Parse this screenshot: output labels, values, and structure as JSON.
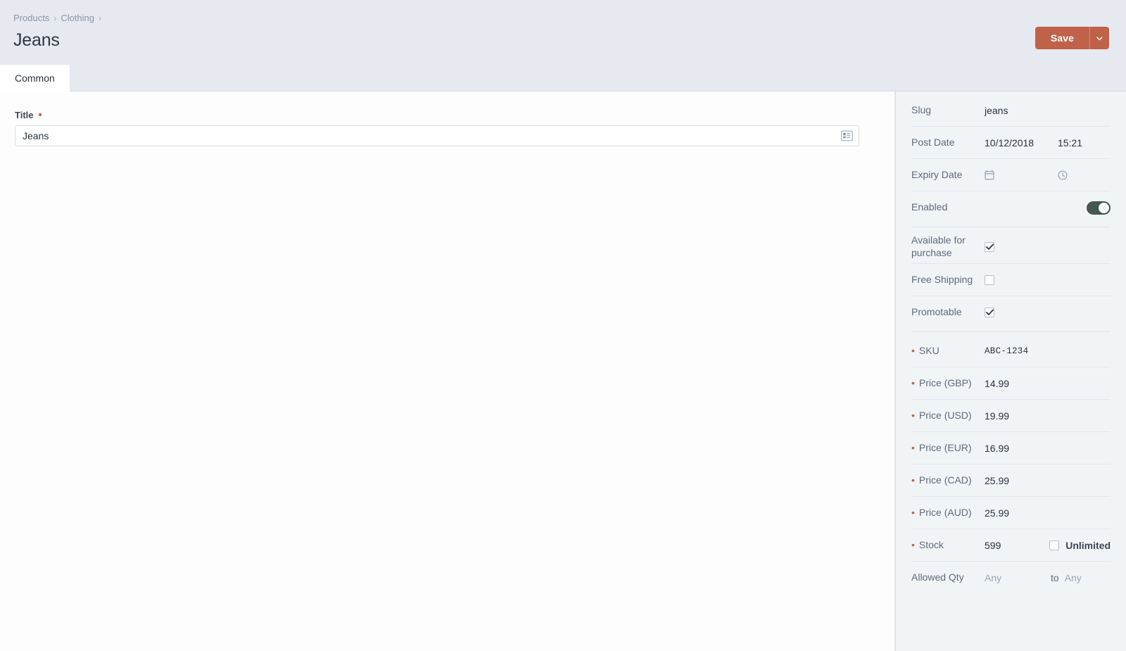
{
  "header": {
    "breadcrumb": [
      {
        "label": "Products"
      },
      {
        "label": "Clothing"
      }
    ],
    "breadcrumb_separator": "›",
    "title": "Jeans",
    "save_label": "Save",
    "save_menu_icon": "chevron-down-icon",
    "accent_color": "#c0614a",
    "background_color": "#e6e9f0"
  },
  "tabs": [
    {
      "label": "Common",
      "active": true
    }
  ],
  "main": {
    "title_field": {
      "label": "Title",
      "required": true,
      "value": "Jeans",
      "placeholder": "",
      "icon": "structure-layout-icon"
    }
  },
  "sidebar": {
    "groups": [
      {
        "rows": [
          {
            "label": "Slug",
            "required": false,
            "type": "text",
            "value": "jeans",
            "placeholder": ""
          },
          {
            "label": "Post Date",
            "required": false,
            "type": "datetime",
            "date": "10/12/2018",
            "time": "15:21",
            "date_icon": "calendar-icon",
            "time_icon": "clock-icon"
          },
          {
            "label": "Expiry Date",
            "required": false,
            "type": "datetime-empty",
            "date": "",
            "time": "",
            "date_icon": "calendar-icon",
            "time_icon": "clock-icon"
          },
          {
            "label": "Enabled",
            "required": false,
            "type": "toggle",
            "checked": true,
            "toggle_color": "#44584e"
          }
        ]
      },
      {
        "rows": [
          {
            "label": "Available for purchase",
            "required": false,
            "type": "checkbox",
            "checked": true
          },
          {
            "label": "Free Shipping",
            "required": false,
            "type": "checkbox",
            "checked": false
          },
          {
            "label": "Promotable",
            "required": false,
            "type": "checkbox",
            "checked": true
          }
        ]
      },
      {
        "rows": [
          {
            "label": "SKU",
            "required": true,
            "type": "mono",
            "value": "ABC-1234",
            "placeholder": ""
          },
          {
            "label": "Price (GBP)",
            "required": true,
            "type": "text",
            "value": "14.99",
            "placeholder": ""
          },
          {
            "label": "Price (USD)",
            "required": true,
            "type": "text",
            "value": "19.99",
            "placeholder": ""
          },
          {
            "label": "Price (EUR)",
            "required": true,
            "type": "text",
            "value": "16.99",
            "placeholder": ""
          },
          {
            "label": "Price (CAD)",
            "required": true,
            "type": "text",
            "value": "25.99",
            "placeholder": ""
          },
          {
            "label": "Price (AUD)",
            "required": true,
            "type": "text",
            "value": "25.99",
            "placeholder": ""
          },
          {
            "label": "Stock",
            "required": true,
            "type": "stock",
            "value": "599",
            "unlimited_label": "Unlimited",
            "unlimited_checked": false
          },
          {
            "label": "Allowed Qty",
            "required": false,
            "type": "range",
            "min_value": "Any",
            "separator": "to",
            "max_value": "Any"
          }
        ]
      }
    ]
  }
}
